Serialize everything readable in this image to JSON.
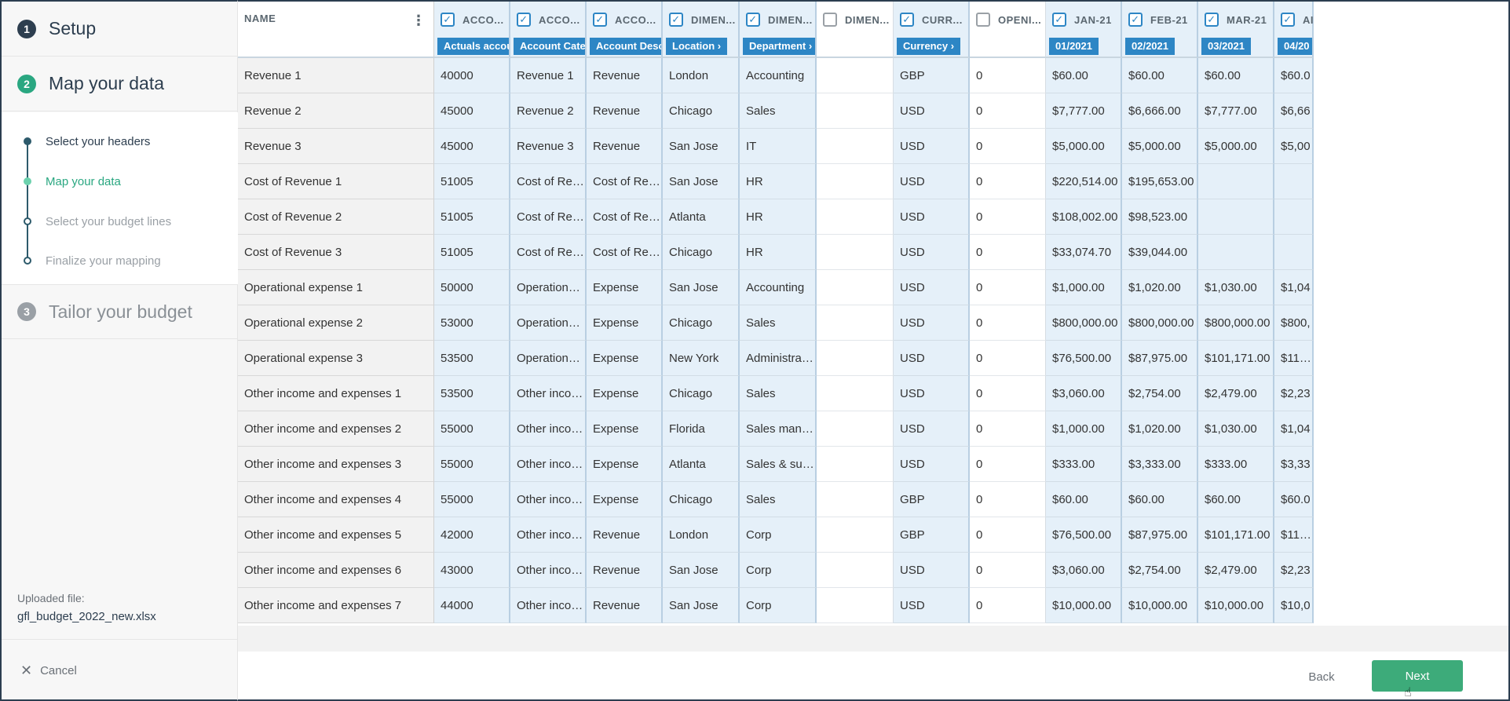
{
  "sidebar": {
    "steps": [
      {
        "num": "1",
        "title": "Setup"
      },
      {
        "num": "2",
        "title": "Map your data"
      },
      {
        "num": "3",
        "title": "Tailor your budget"
      }
    ],
    "substeps": [
      {
        "label": "Select your headers",
        "state": "done"
      },
      {
        "label": "Map your data",
        "state": "active"
      },
      {
        "label": "Select your budget lines",
        "state": "pending"
      },
      {
        "label": "Finalize your mapping",
        "state": "pending"
      }
    ],
    "uploaded_label": "Uploaded file:",
    "uploaded_file": "gfl_budget_2022_new.xlsx",
    "cancel_label": "Cancel"
  },
  "grid": {
    "name_header": "NAME",
    "columns": [
      {
        "header": "ACCO...",
        "checked": true,
        "tag": "Actuals account ›"
      },
      {
        "header": "ACCO...",
        "checked": true,
        "tag": "Account Category ›"
      },
      {
        "header": "ACCO...",
        "checked": true,
        "tag": "Account Description"
      },
      {
        "header": "DIMEN...",
        "checked": true,
        "tag": "Location ›"
      },
      {
        "header": "DIMEN...",
        "checked": true,
        "tag": "Department ›"
      },
      {
        "header": "DIMEN...",
        "checked": false,
        "tag": ""
      },
      {
        "header": "CURR...",
        "checked": true,
        "tag": "Currency ›"
      },
      {
        "header": "OPENI...",
        "checked": false,
        "tag": ""
      },
      {
        "header": "JAN-21",
        "checked": true,
        "tag": "01/2021"
      },
      {
        "header": "FEB-21",
        "checked": true,
        "tag": "02/2021"
      },
      {
        "header": "MAR-21",
        "checked": true,
        "tag": "03/2021"
      },
      {
        "header": "AI",
        "checked": true,
        "tag": "04/20"
      }
    ],
    "rows": [
      [
        "Revenue 1",
        "40000",
        "Revenue 1",
        "Revenue",
        "London",
        "Accounting",
        "",
        "GBP",
        "0",
        "$60.00",
        "$60.00",
        "$60.00",
        "$60.0"
      ],
      [
        "Revenue 2",
        "45000",
        "Revenue 2",
        "Revenue",
        "Chicago",
        "Sales",
        "",
        "USD",
        "0",
        "$7,777.00",
        "$6,666.00",
        "$7,777.00",
        "$6,66"
      ],
      [
        "Revenue 3",
        "45000",
        "Revenue 3",
        "Revenue",
        "San Jose",
        "IT",
        "",
        "USD",
        "0",
        "$5,000.00",
        "$5,000.00",
        "$5,000.00",
        "$5,00"
      ],
      [
        "Cost of Revenue 1",
        "51005",
        "Cost of Reve...",
        "Cost of Reve...",
        "San Jose",
        "HR",
        "",
        "USD",
        "0",
        "$220,514.00",
        "$195,653.00",
        "",
        ""
      ],
      [
        "Cost of Revenue 2",
        "51005",
        "Cost of Reve...",
        "Cost of Reve...",
        "Atlanta",
        "HR",
        "",
        "USD",
        "0",
        "$108,002.00",
        "$98,523.00",
        "",
        ""
      ],
      [
        "Cost of Revenue 3",
        "51005",
        "Cost of Reve...",
        "Cost of Reve...",
        "Chicago",
        "HR",
        "",
        "USD",
        "0",
        "$33,074.70",
        "$39,044.00",
        "",
        ""
      ],
      [
        "Operational expense 1",
        "50000",
        "Operational ...",
        "Expense",
        "San Jose",
        "Accounting",
        "",
        "USD",
        "0",
        "$1,000.00",
        "$1,020.00",
        "$1,030.00",
        "$1,04"
      ],
      [
        "Operational expense 2",
        "53000",
        "Operational ...",
        "Expense",
        "Chicago",
        "Sales",
        "",
        "USD",
        "0",
        "$800,000.00",
        "$800,000.00",
        "$800,000.00",
        "$800,"
      ],
      [
        "Operational expense 3",
        "53500",
        "Operational ...",
        "Expense",
        "New York",
        "Administrati...",
        "",
        "USD",
        "0",
        "$76,500.00",
        "$87,975.00",
        "$101,171.00",
        "$116,3"
      ],
      [
        "Other income and expenses 1",
        "53500",
        "Other incom...",
        "Expense",
        "Chicago",
        "Sales",
        "",
        "USD",
        "0",
        "$3,060.00",
        "$2,754.00",
        "$2,479.00",
        "$2,23"
      ],
      [
        "Other income and expenses 2",
        "55000",
        "Other incom...",
        "Expense",
        "Florida",
        "Sales manag...",
        "",
        "USD",
        "0",
        "$1,000.00",
        "$1,020.00",
        "$1,030.00",
        "$1,04"
      ],
      [
        "Other income and expenses 3",
        "55000",
        "Other incom...",
        "Expense",
        "Atlanta",
        "Sales & supp...",
        "",
        "USD",
        "0",
        "$333.00",
        "$3,333.00",
        "$333.00",
        "$3,33"
      ],
      [
        "Other income and expenses 4",
        "55000",
        "Other incom...",
        "Expense",
        "Chicago",
        "Sales",
        "",
        "GBP",
        "0",
        "$60.00",
        "$60.00",
        "$60.00",
        "$60.0"
      ],
      [
        "Other income and expenses 5",
        "42000",
        "Other incom...",
        "Revenue",
        "London",
        "Corp",
        "",
        "GBP",
        "0",
        "$76,500.00",
        "$87,975.00",
        "$101,171.00",
        "$116,3"
      ],
      [
        "Other income and expenses 6",
        "43000",
        "Other incom...",
        "Revenue",
        "San Jose",
        "Corp",
        "",
        "USD",
        "0",
        "$3,060.00",
        "$2,754.00",
        "$2,479.00",
        "$2,23"
      ],
      [
        "Other income and expenses 7",
        "44000",
        "Other incom...",
        "Revenue",
        "San Jose",
        "Corp",
        "",
        "USD",
        "0",
        "$10,000.00",
        "$10,000.00",
        "$10,000.00",
        "$10,0"
      ]
    ]
  },
  "footer": {
    "back_label": "Back",
    "next_label": "Next"
  },
  "colors": {
    "accent_green": "#2aa781",
    "selected_column": "#e5f0f9",
    "tag_blue": "#2d86c5",
    "next_button": "#3dab7a"
  }
}
